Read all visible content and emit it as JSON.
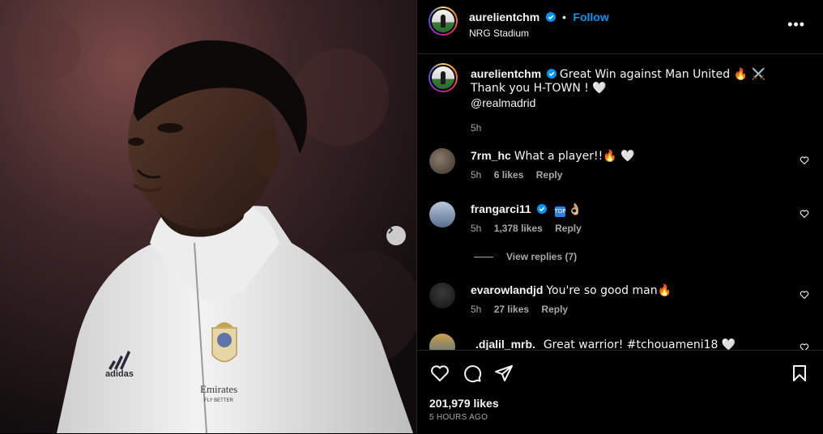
{
  "post": {
    "username": "aurelientchm",
    "follow_label": "Follow",
    "separator": "•",
    "location": "NRG Stadium",
    "more_label": "•••",
    "caption_line1": "Great Win against Man United 🔥 ⚔️",
    "caption_line2": "Thank you H-TOWN ! 🤍",
    "caption_line3": "@realmadrid",
    "caption_time": "5h",
    "likes": "201,979 likes",
    "time_ago": "5 HOURS AGO"
  },
  "comments": [
    {
      "username": "7rm_hc",
      "text": "What a player!!🔥 🤍",
      "time": "5h",
      "likes": "6 likes",
      "reply": "Reply"
    },
    {
      "username": "frangarci11",
      "text": "👌🏼",
      "time": "5h",
      "likes": "1,378 likes",
      "reply": "Reply",
      "badge": "TOP"
    },
    {
      "username": "evarowlandjd",
      "text": "You're so good man🔥",
      "time": "5h",
      "likes": "27 likes",
      "reply": "Reply"
    },
    {
      "username": ".djalil_mrb.",
      "text": "Great warrior! #tchouameni18 🤍"
    }
  ],
  "view_replies": "View replies (7)",
  "colors": {
    "accent": "#0095f6",
    "muted": "#a8a8a8",
    "background": "#000000"
  }
}
